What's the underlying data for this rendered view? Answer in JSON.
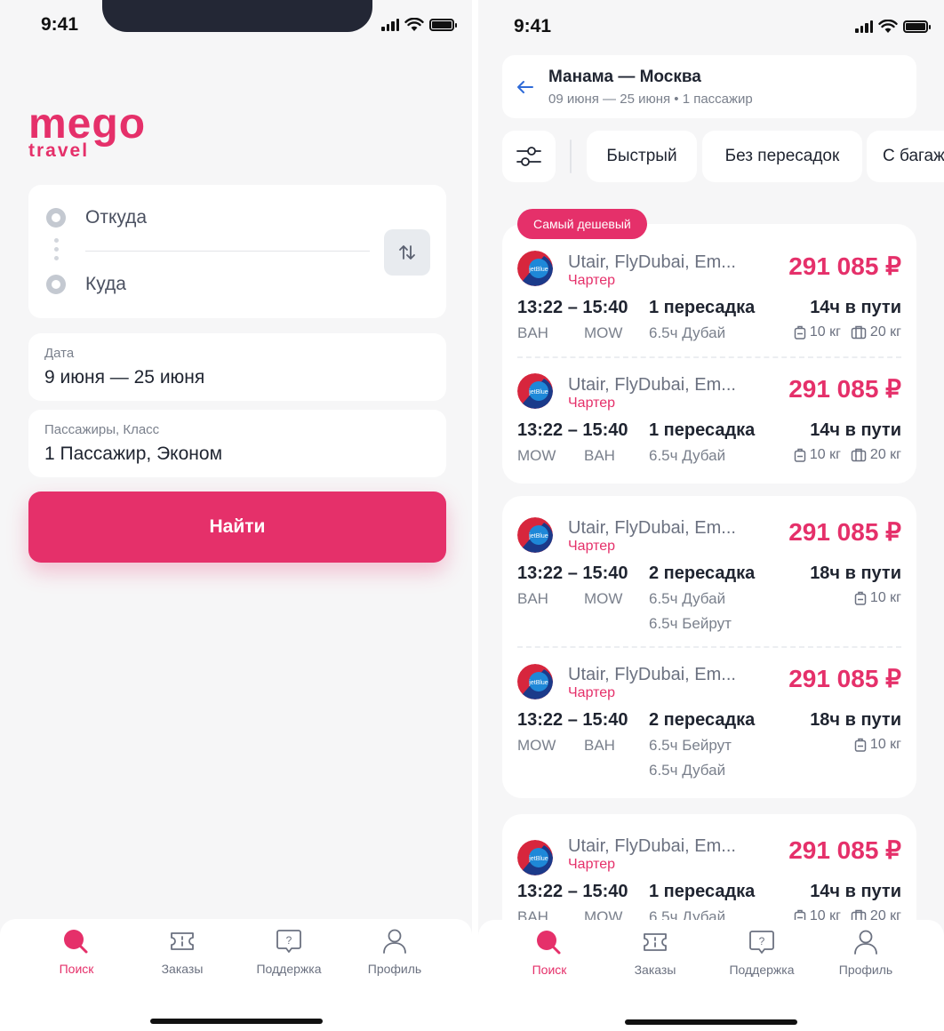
{
  "status": {
    "time": "9:41"
  },
  "search_screen": {
    "logo": {
      "primary": "mego",
      "secondary": "travel"
    },
    "from_placeholder": "Откуда",
    "to_placeholder": "Куда",
    "date": {
      "caption": "Дата",
      "value": "9 июня — 25 июня"
    },
    "passengers": {
      "caption": "Пассажиры, Класс",
      "value": "1 Пассажир, Эконом"
    },
    "find_button": "Найти"
  },
  "tabs": [
    {
      "label": "Поиск",
      "icon": "search-icon",
      "active": true
    },
    {
      "label": "Заказы",
      "icon": "ticket-icon",
      "active": false
    },
    {
      "label": "Поддержка",
      "icon": "support-icon",
      "active": false
    },
    {
      "label": "Профиль",
      "icon": "profile-icon",
      "active": false
    }
  ],
  "results_screen": {
    "route": "Манама — Москва",
    "subtitle": "09 июня — 25 июня • 1 пассажир",
    "filters": [
      "Быстрый",
      "Без пересадок",
      "С багаж"
    ],
    "badge": "Самый дешевый",
    "results": [
      {
        "flights": [
          {
            "airline": "Utair, FlyDubai, Em...",
            "charter": "Чартер",
            "price": "291 085 ₽",
            "times": "13:22 – 15:40",
            "stops": "1 пересадка",
            "duration": "14ч в пути",
            "from": "BAH",
            "to": "MOW",
            "via": [
              "6.5ч Дубай"
            ],
            "baggage": "10 кг",
            "carryon": "20 кг"
          },
          {
            "airline": "Utair, FlyDubai, Em...",
            "charter": "Чартер",
            "price": "291 085 ₽",
            "times": "13:22 – 15:40",
            "stops": "1 пересадка",
            "duration": "14ч в пути",
            "from": "MOW",
            "to": "BAH",
            "via": [
              "6.5ч Дубай"
            ],
            "baggage": "10 кг",
            "carryon": "20 кг"
          }
        ]
      },
      {
        "flights": [
          {
            "airline": "Utair, FlyDubai, Em...",
            "charter": "Чартер",
            "price": "291 085 ₽",
            "times": "13:22 – 15:40",
            "stops": "2 пересадка",
            "duration": "18ч в пути",
            "from": "BAH",
            "to": "MOW",
            "via": [
              "6.5ч Дубай",
              "6.5ч Бейрут"
            ],
            "baggage": "10 кг"
          },
          {
            "airline": "Utair, FlyDubai, Em...",
            "charter": "Чартер",
            "price": "291 085 ₽",
            "times": "13:22 – 15:40",
            "stops": "2 пересадка",
            "duration": "18ч в пути",
            "from": "MOW",
            "to": "BAH",
            "via": [
              "6.5ч Бейрут",
              "6.5ч Дубай"
            ],
            "baggage": "10 кг"
          }
        ]
      },
      {
        "flights": [
          {
            "airline": "Utair, FlyDubai, Em...",
            "charter": "Чартер",
            "price": "291 085 ₽",
            "times": "13:22 – 15:40",
            "stops": "1 пересадка",
            "duration": "14ч в пути",
            "from": "BAH",
            "to": "MOW",
            "via": [
              "6.5ч Дубай"
            ],
            "baggage": "10 кг",
            "carryon": "20 кг"
          }
        ]
      }
    ]
  },
  "colors": {
    "accent": "#e5306a",
    "background": "#f6f6f7",
    "card": "#ffffff"
  }
}
